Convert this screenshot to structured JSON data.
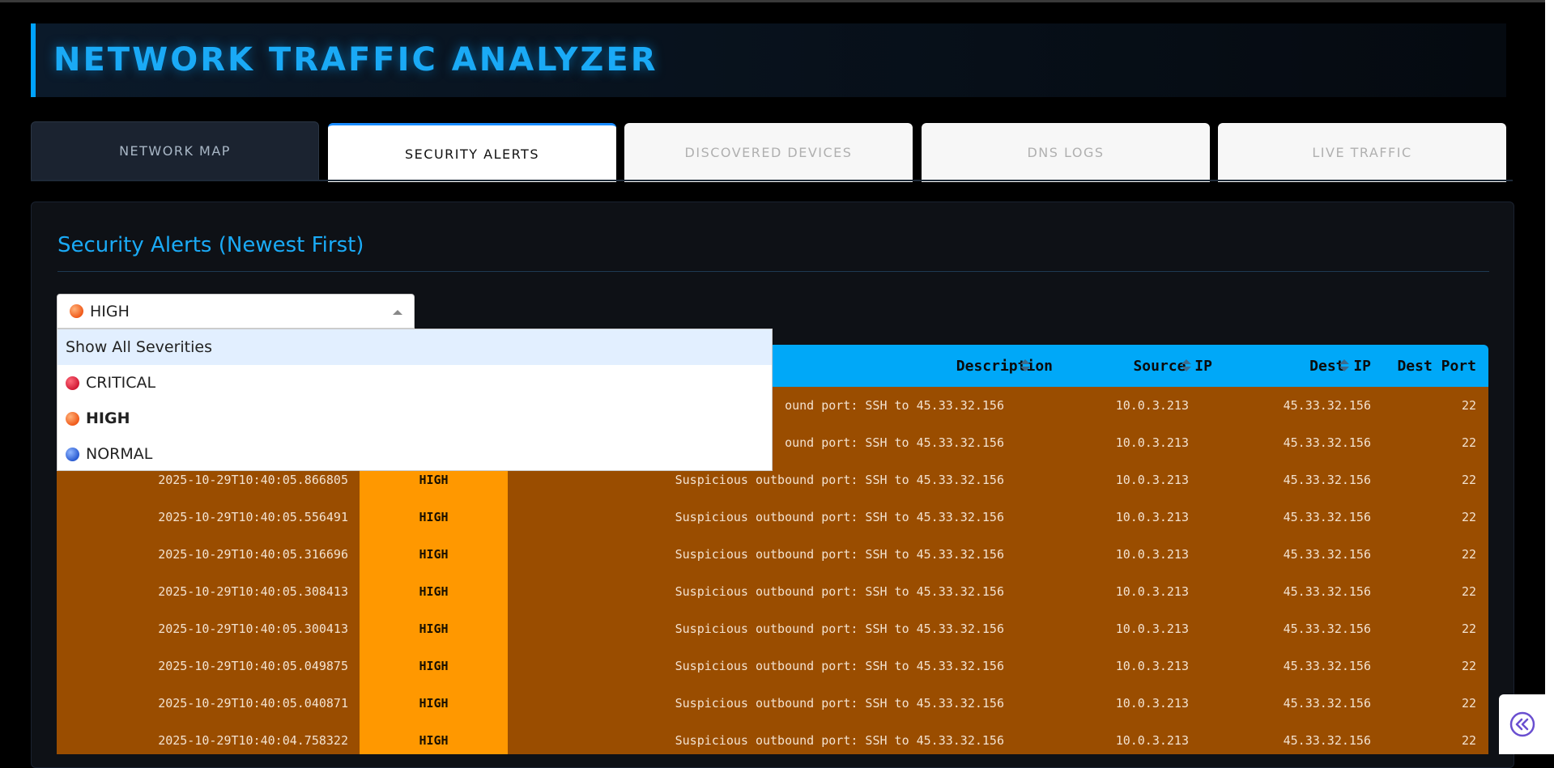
{
  "header": {
    "title": "NETWORK TRAFFIC ANALYZER"
  },
  "tabs": [
    {
      "label": "NETWORK MAP",
      "state": "dark"
    },
    {
      "label": "SECURITY ALERTS",
      "state": "active"
    },
    {
      "label": "DISCOVERED DEVICES",
      "state": "inactive"
    },
    {
      "label": "DNS LOGS",
      "state": "inactive"
    },
    {
      "label": "LIVE TRAFFIC",
      "state": "inactive"
    }
  ],
  "panel": {
    "title": "Security Alerts (Newest First)"
  },
  "filter": {
    "selected_label": "HIGH",
    "selected_icon": "high-dot-icon",
    "options": [
      {
        "label": "Show All Severities",
        "icon": ""
      },
      {
        "label": "CRITICAL",
        "icon": "critical-dot-icon"
      },
      {
        "label": "HIGH",
        "icon": "high-dot-icon"
      },
      {
        "label": "NORMAL",
        "icon": "normal-dot-icon"
      }
    ]
  },
  "table": {
    "columns": [
      "Description",
      "Source IP",
      "Dest IP",
      "Dest Port"
    ],
    "rows": [
      {
        "timestamp": "",
        "severity": "",
        "description": "ound port: SSH to 45.33.32.156",
        "source_ip": "10.0.3.213",
        "dest_ip": "45.33.32.156",
        "dest_port": "22"
      },
      {
        "timestamp": "",
        "severity": "",
        "description": "ound port: SSH to 45.33.32.156",
        "source_ip": "10.0.3.213",
        "dest_ip": "45.33.32.156",
        "dest_port": "22"
      },
      {
        "timestamp": "2025-10-29T10:40:05.866805",
        "severity": "HIGH",
        "description": "Suspicious outbound port: SSH to 45.33.32.156",
        "source_ip": "10.0.3.213",
        "dest_ip": "45.33.32.156",
        "dest_port": "22"
      },
      {
        "timestamp": "2025-10-29T10:40:05.556491",
        "severity": "HIGH",
        "description": "Suspicious outbound port: SSH to 45.33.32.156",
        "source_ip": "10.0.3.213",
        "dest_ip": "45.33.32.156",
        "dest_port": "22"
      },
      {
        "timestamp": "2025-10-29T10:40:05.316696",
        "severity": "HIGH",
        "description": "Suspicious outbound port: SSH to 45.33.32.156",
        "source_ip": "10.0.3.213",
        "dest_ip": "45.33.32.156",
        "dest_port": "22"
      },
      {
        "timestamp": "2025-10-29T10:40:05.308413",
        "severity": "HIGH",
        "description": "Suspicious outbound port: SSH to 45.33.32.156",
        "source_ip": "10.0.3.213",
        "dest_ip": "45.33.32.156",
        "dest_port": "22"
      },
      {
        "timestamp": "2025-10-29T10:40:05.300413",
        "severity": "HIGH",
        "description": "Suspicious outbound port: SSH to 45.33.32.156",
        "source_ip": "10.0.3.213",
        "dest_ip": "45.33.32.156",
        "dest_port": "22"
      },
      {
        "timestamp": "2025-10-29T10:40:05.049875",
        "severity": "HIGH",
        "description": "Suspicious outbound port: SSH to 45.33.32.156",
        "source_ip": "10.0.3.213",
        "dest_ip": "45.33.32.156",
        "dest_port": "22"
      },
      {
        "timestamp": "2025-10-29T10:40:05.040871",
        "severity": "HIGH",
        "description": "Suspicious outbound port: SSH to 45.33.32.156",
        "source_ip": "10.0.3.213",
        "dest_ip": "45.33.32.156",
        "dest_port": "22"
      },
      {
        "timestamp": "2025-10-29T10:40:04.758322",
        "severity": "HIGH",
        "description": "Suspicious outbound port: SSH to 45.33.32.156",
        "source_ip": "10.0.3.213",
        "dest_ip": "45.33.32.156",
        "dest_port": "22"
      }
    ]
  },
  "corner_button": {
    "icon": "double-chevron-left-icon"
  },
  "colors": {
    "accent": "#00a8f8",
    "row_high_bg": "#9a4d00",
    "severity_high_bg": "#ff9800"
  }
}
